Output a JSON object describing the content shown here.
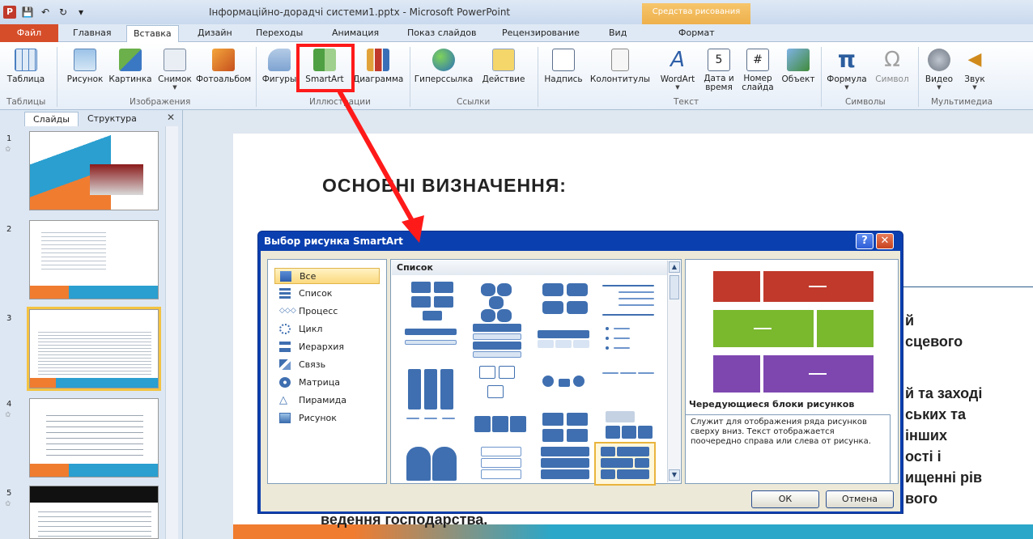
{
  "window": {
    "title": "Інформаційно-дорадчі системи1.pptx - Microsoft PowerPoint",
    "context_tab_group": "Средства рисования"
  },
  "tabs": [
    "Файл",
    "Главная",
    "Вставка",
    "Дизайн",
    "Переходы",
    "Анимация",
    "Показ слайдов",
    "Рецензирование",
    "Вид",
    "Формат"
  ],
  "ribbon": {
    "buttons": {
      "table": "Таблица",
      "picture": "Рисунок",
      "clipart": "Картинка",
      "screenshot": "Снимок",
      "album": "Фотоальбом",
      "shapes": "Фигуры",
      "smartart": "SmartArt",
      "chart": "Диаграмма",
      "hyperlink": "Гиперссылка",
      "action": "Действие",
      "textbox": "Надпись",
      "headerfooter": "Колонтитулы",
      "wordart": "WordArt",
      "datetime": "Дата и время",
      "slidenum": "Номер слайда",
      "object": "Объект",
      "equation": "Формула",
      "symbol": "Символ",
      "video": "Видео",
      "audio": "Звук"
    },
    "groups": {
      "tables": "Таблицы",
      "images": "Изображения",
      "illustrations": "Иллюстрации",
      "links": "Ссылки",
      "text": "Текст",
      "symbols": "Символы",
      "media": "Мультимедиа"
    }
  },
  "slide_pane": {
    "tab_slides": "Слайды",
    "tab_outline": "Структура",
    "close": "✕",
    "thumbs": [
      {
        "num": "1"
      },
      {
        "num": "2"
      },
      {
        "num": "3"
      },
      {
        "num": "4"
      },
      {
        "num": "5"
      }
    ]
  },
  "slide": {
    "title": "ОСНОВНІ ВИЗНАЧЕННЯ:",
    "fragments": [
      "й",
      "сцевого",
      "й та заході",
      "ських та",
      "інших",
      "ості і",
      "ищенні рів",
      "вого",
      "ведення господарства."
    ]
  },
  "dialog": {
    "title": "Выбор рисунка SmartArt",
    "help": "?",
    "close": "✕",
    "categories": [
      "Все",
      "Список",
      "Процесс",
      "Цикл",
      "Иерархия",
      "Связь",
      "Матрица",
      "Пирамида",
      "Рисунок"
    ],
    "gallery_header": "Список",
    "preview_name": "Чередующиеся блоки рисунков",
    "preview_desc": "Служит для отображения ряда рисунков сверху вниз. Текст отображается поочередно справа или слева от рисунка.",
    "ok": "ОК",
    "cancel": "Отмена"
  },
  "colors": {
    "accent_red": "#ff1a1a",
    "preview_red": "#c0392b",
    "preview_green": "#7ab82e",
    "preview_purple": "#7e47b0",
    "dialog_title": "#0a3fb0"
  }
}
